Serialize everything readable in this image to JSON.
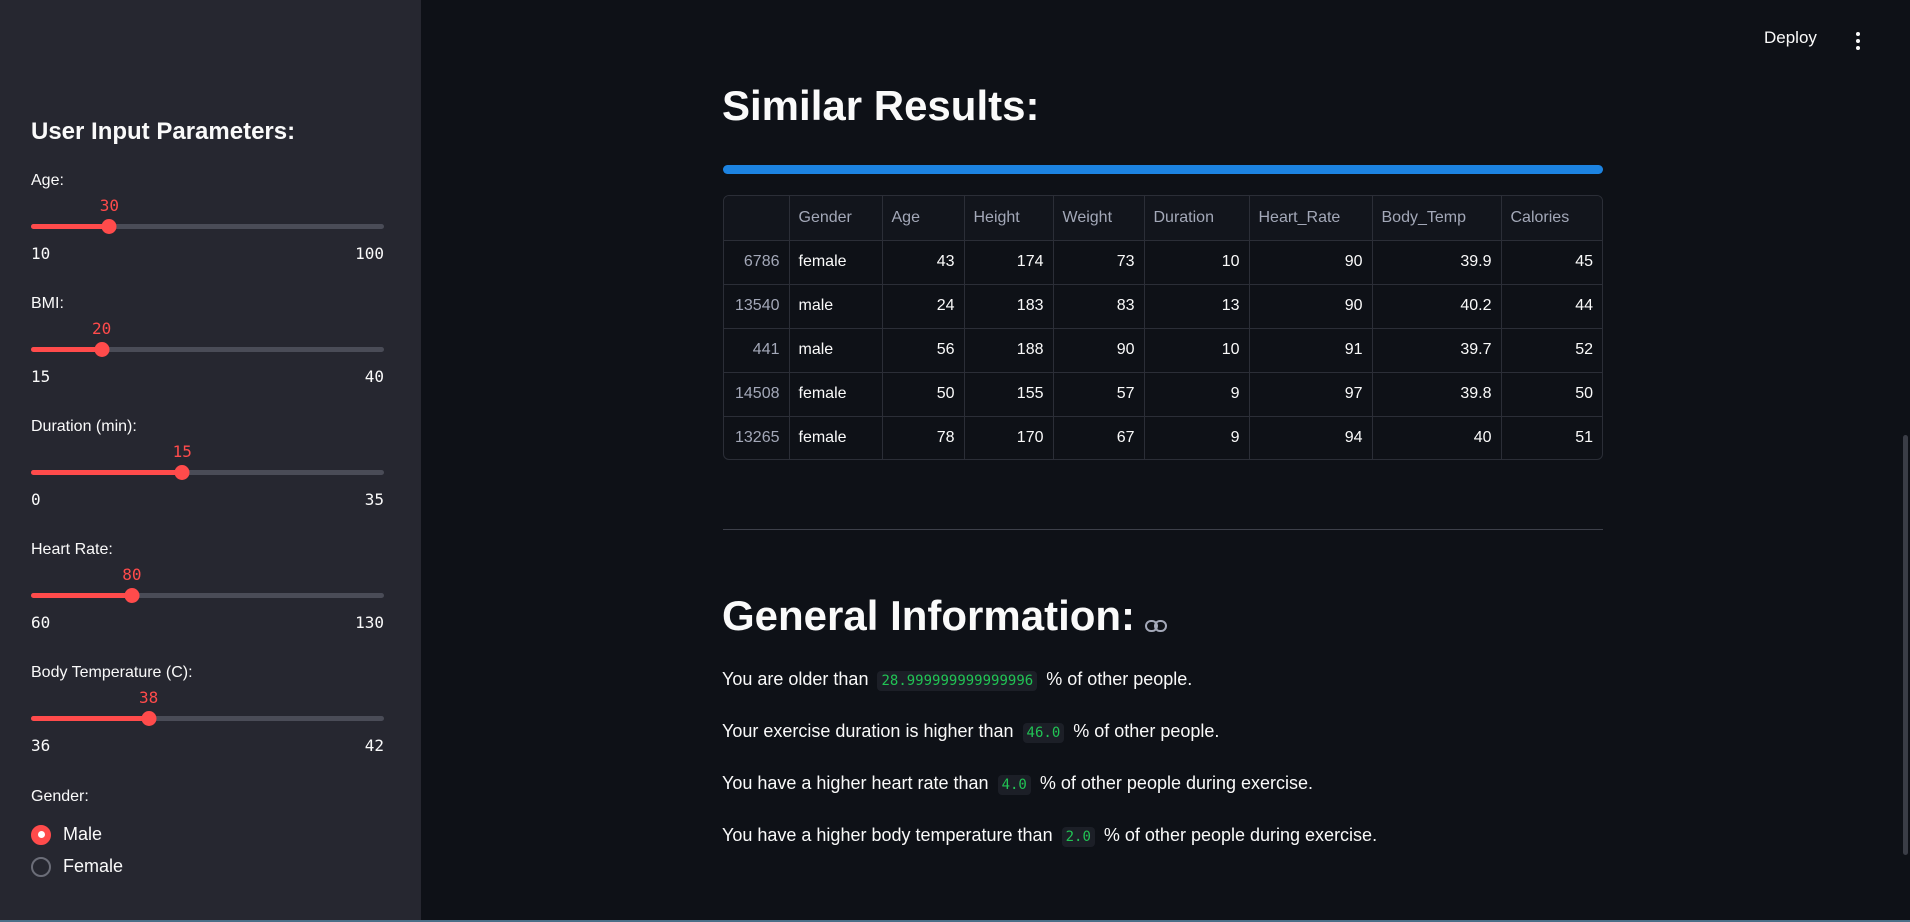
{
  "sidebar": {
    "title": "User Input Parameters:",
    "sliders": [
      {
        "label": "Age:",
        "value": "30",
        "min": "10",
        "max": "100",
        "fraction": 0.222
      },
      {
        "label": "BMI:",
        "value": "20",
        "min": "15",
        "max": "40",
        "fraction": 0.2
      },
      {
        "label": "Duration (min):",
        "value": "15",
        "min": "0",
        "max": "35",
        "fraction": 0.4286
      },
      {
        "label": "Heart Rate:",
        "value": "80",
        "min": "60",
        "max": "130",
        "fraction": 0.2857
      },
      {
        "label": "Body Temperature (C):",
        "value": "38",
        "min": "36",
        "max": "42",
        "fraction": 0.3333
      }
    ],
    "gender": {
      "label": "Gender:",
      "options": [
        "Male",
        "Female"
      ],
      "selected": "Male"
    }
  },
  "header": {
    "deploy_label": "Deploy",
    "menu_icon": "more-vert-icon"
  },
  "main": {
    "similar_title": "Similar Results:",
    "progress": 1.0,
    "table": {
      "columns": [
        "",
        "Gender",
        "Age",
        "Height",
        "Weight",
        "Duration",
        "Heart_Rate",
        "Body_Temp",
        "Calories"
      ],
      "rows": [
        [
          "6786",
          "female",
          "43",
          "174",
          "73",
          "10",
          "90",
          "39.9",
          "45"
        ],
        [
          "13540",
          "male",
          "24",
          "183",
          "83",
          "13",
          "90",
          "40.2",
          "44"
        ],
        [
          "441",
          "male",
          "56",
          "188",
          "90",
          "10",
          "91",
          "39.7",
          "52"
        ],
        [
          "14508",
          "female",
          "50",
          "155",
          "57",
          "9",
          "97",
          "39.8",
          "50"
        ],
        [
          "13265",
          "female",
          "78",
          "170",
          "67",
          "9",
          "94",
          "40",
          "51"
        ]
      ]
    },
    "general_title": "General Information:",
    "info": [
      {
        "before": "You are older than",
        "value": "28.999999999999996",
        "after": "% of other people."
      },
      {
        "before": "Your exercise duration is higher than",
        "value": "46.0",
        "after": "% of other people."
      },
      {
        "before": "You have a higher heart rate than",
        "value": "4.0",
        "after": "% of other people during exercise."
      },
      {
        "before": "You have a higher body temperature than",
        "value": "2.0",
        "after": "% of other people during exercise."
      }
    ]
  },
  "colors": {
    "accent": "#ff4b4b",
    "progress": "#1c83e1",
    "code_text": "#21c354",
    "background": "#0e1117",
    "sidebar_bg": "#262730"
  }
}
